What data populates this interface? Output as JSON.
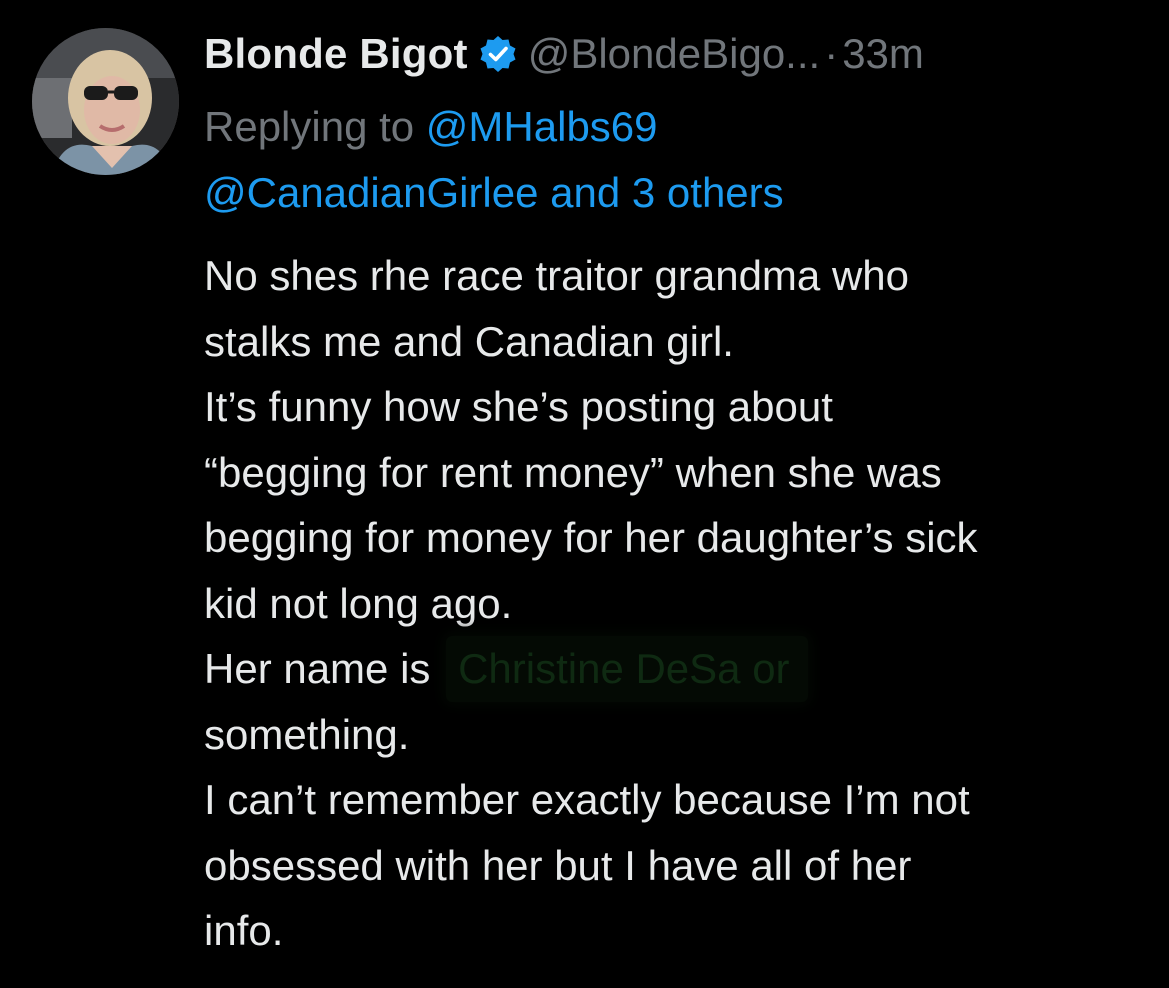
{
  "tweet": {
    "display_name": "Blonde Bigot",
    "handle": "@BlondeBigo...",
    "separator": "·",
    "time": "33m",
    "replying_prefix": "Replying to ",
    "reply_mention_1": "@MHalbs69",
    "reply_mention_2": "@CanadianGirlee",
    "reply_others": " and 3 others",
    "body_lines": [
      "No shes rhe race traitor grandma who",
      "stalks me and Canadian girl.",
      "It’s funny how she’s posting about",
      "“begging for rent money” when she was",
      "begging for money for her daughter’s sick",
      "kid not long ago."
    ],
    "name_line_prefix": "Her name is ",
    "redacted_text": "Christine DeSa or",
    "body_lines_after": [
      "something.",
      "I can’t remember exactly because I’m not",
      "obsessed with her but I have all of her",
      "info."
    ]
  },
  "icons": {
    "verified": "verified-badge-icon",
    "more": "more-options-icon"
  },
  "colors": {
    "background": "#000000",
    "text_primary": "#e7e9ea",
    "text_secondary": "#71767b",
    "accent": "#1d9bf0"
  }
}
